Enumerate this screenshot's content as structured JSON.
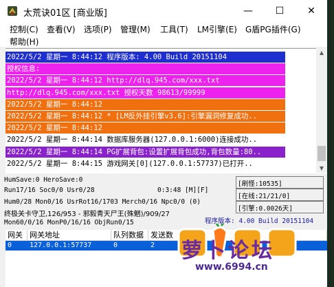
{
  "window": {
    "title": "太荒诀01区 [商业版]",
    "min_glyph": "—",
    "max_glyph": "☐",
    "close_glyph": "✕"
  },
  "menu": [
    "控制(C)",
    "查看(V)",
    "选项(P)",
    "管理(M)",
    "工具(T)",
    "LM引擎(E)",
    "G盾PG插件(G)",
    "帮助(H)"
  ],
  "log": [
    {
      "text": "2022/5/2 星期一 8:44:12 程序版本: 4.00 Build 20151104",
      "bg": "#1f2fcf",
      "fg": "#ffffff"
    },
    {
      "text": "授权信息:",
      "bg": "#ee22ee",
      "fg": "#ffffff"
    },
    {
      "text": "2022/5/2 星期一 8:44:12 http://dlq.945.com/xxx.txt",
      "bg": "#ee22ee",
      "fg": "#ffffff"
    },
    {
      "text": "http://dlq.945.com/xxx.txt 授权天数 98613/99999",
      "bg": "#ee22ee",
      "fg": "#ffffff"
    },
    {
      "text": "2022/5/2 星期一 8:44:12 ",
      "bg": "#f07010",
      "fg": "#ffffff"
    },
    {
      "text": "2022/5/2 星期一 8:44:12 * [LM反外挂引擎v3.6]:引擎漏洞修复成功..",
      "bg": "#f07010",
      "fg": "#ffffff"
    },
    {
      "text": "2022/5/2 星期一 8:44:12 ",
      "bg": "#f07010",
      "fg": "#ffffff"
    },
    {
      "text": "2022/5/2 星期一 8:44:14 数据库服务器(127.0.0.1:6000)连接成功..",
      "bg": "#ffffff",
      "fg": "#000000"
    },
    {
      "text": "2022/5/2 星期一 8:44:14 PG扩展背包:设置扩展背包成功,背包数量:80..",
      "bg": "#8a22cc",
      "fg": "#ffffff"
    },
    {
      "text": "2022/5/2 星期一 8:44:15 游戏网关[0](127.0.0.1:57737)已打开..",
      "bg": "#ffffff",
      "fg": "#000000"
    }
  ],
  "status": {
    "line1": "HumSave:0 HeroSave:0",
    "line2": "Run17/16 Soc0/0 Usr0/28",
    "timer": "0:3:48 [M][F]",
    "line3": "Hum0/28 Mon0/16 UsrRot16/1703 Merch0/16 Npc0/0 (0)",
    "line4": "终极关卡守卫,126/953 - 邪毅青天尸王(殊魍)/909/27",
    "line5": "Mon60/0/16 MonP0/16/16 ObjRun0/15",
    "refresh": "[刷怪:10535]",
    "online": "[在线:21/21/0]",
    "engine": "[引擎:0.0026天]",
    "version": "程序版本: 4.00 Build 20151104"
  },
  "table": {
    "headers": [
      "网关",
      "网关地址",
      "队列数据",
      "发送数",
      "",
      ""
    ],
    "row": [
      "0",
      "127.0.0.1:57737",
      "0",
      "2",
      "",
      ""
    ]
  },
  "watermark": {
    "logo_text": "萝卜论坛",
    "url": "www.6994.cn"
  }
}
